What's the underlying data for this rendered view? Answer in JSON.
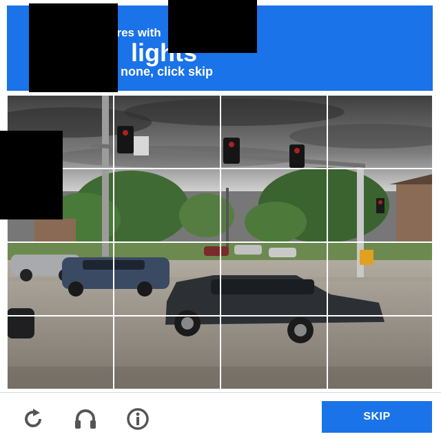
{
  "header": {
    "line1": "ares with",
    "line2": "lights",
    "line3": "none, click skip",
    "bg_color": "#1a73e8"
  },
  "grid": {
    "rows": 4,
    "cols": 4,
    "tiles": [
      "tile-1-1",
      "tile-1-2",
      "tile-1-3",
      "tile-1-4",
      "tile-2-1",
      "tile-2-2",
      "tile-2-3",
      "tile-2-4",
      "tile-3-1",
      "tile-3-2",
      "tile-3-3",
      "tile-3-4",
      "tile-4-1",
      "tile-4-2",
      "tile-4-3",
      "tile-4-4"
    ]
  },
  "footer": {
    "skip_label": "SKIP",
    "icons": [
      "reload-icon",
      "headphones-icon",
      "info-icon"
    ],
    "icon_color": "#555555",
    "button_color": "#1a73e8"
  }
}
